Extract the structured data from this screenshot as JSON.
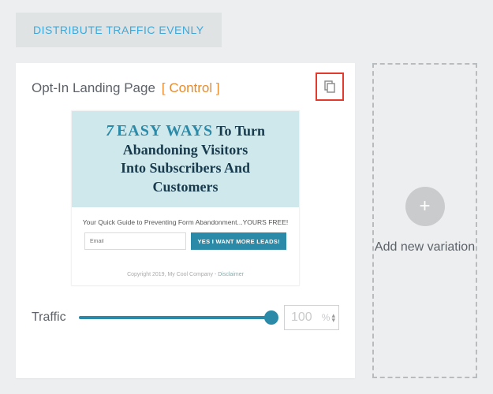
{
  "distribute_label": "DISTRIBUTE TRAFFIC EVENLY",
  "card": {
    "title": "Opt-In Landing Page",
    "tag": "[ Control ]",
    "preview": {
      "hero_num": "7",
      "hero_easy": "EASY WAYS",
      "hero_rest1": "To Turn",
      "hero_line2": "Abandoning Visitors",
      "hero_line3": "Into Subscribers And",
      "hero_line4": "Customers",
      "subhead": "Your Quick Guide to Preventing Form Abandonment...YOURS FREE!",
      "email_placeholder": "Email",
      "cta": "YES I WANT MORE LEADS!",
      "footer_copy": "Copyright 2019, My Cool Company - ",
      "footer_disclaimer": "Disclaimer"
    },
    "traffic_label": "Traffic",
    "traffic_value": "100",
    "traffic_unit": "%"
  },
  "add_variation_label": "Add new variation"
}
